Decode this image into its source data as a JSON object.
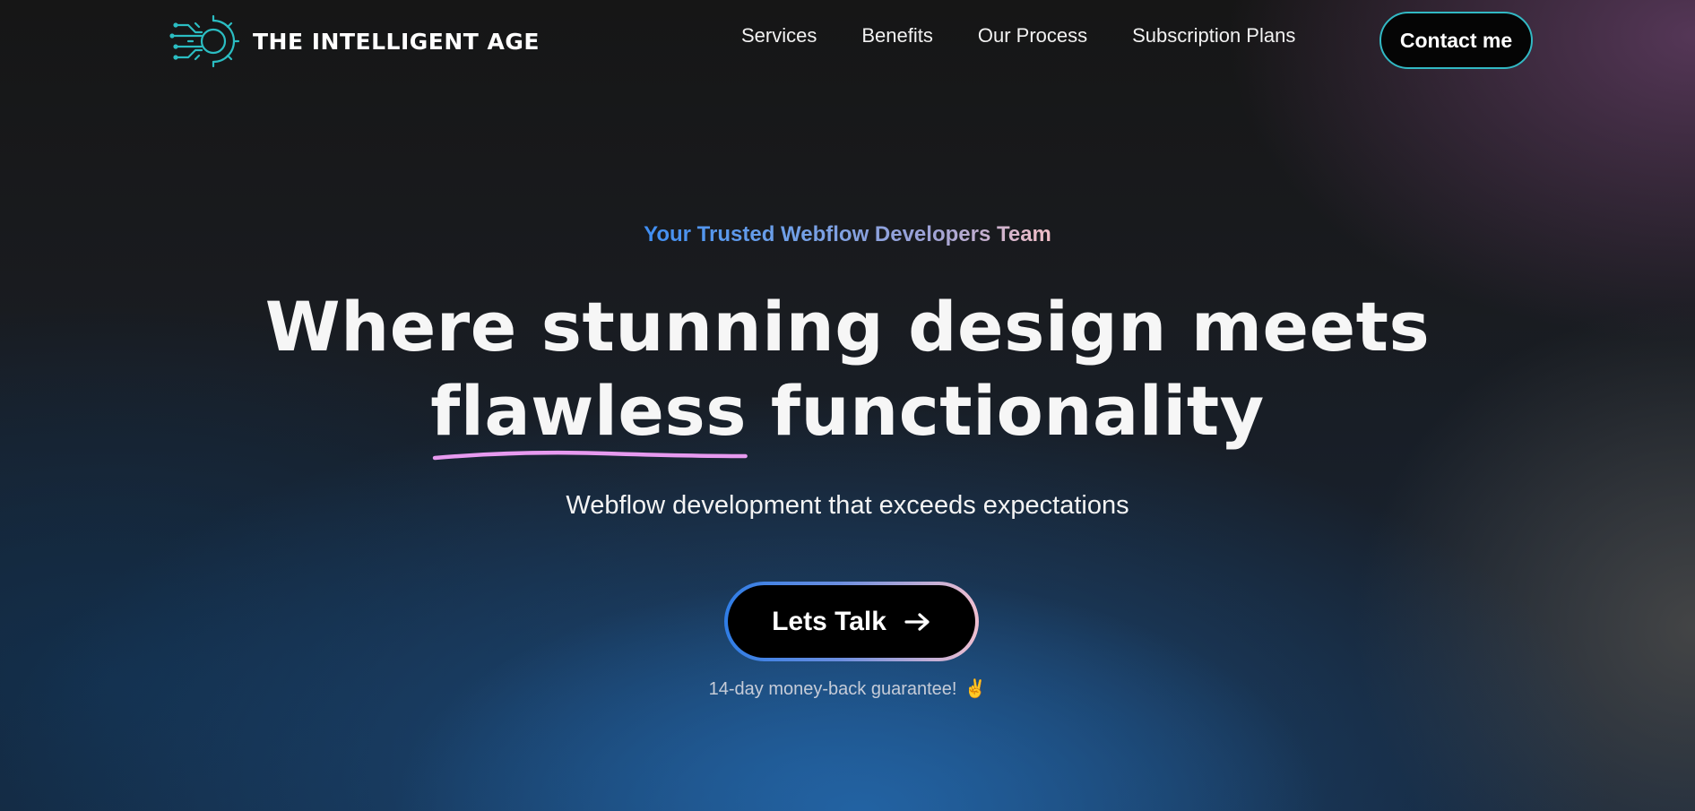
{
  "header": {
    "brand": "THE INTELLIGENT AGE",
    "nav": [
      {
        "label": "Services"
      },
      {
        "label": "Benefits"
      },
      {
        "label": "Our Process"
      },
      {
        "label": "Subscription Plans"
      }
    ],
    "contact_label": "Contact me"
  },
  "hero": {
    "eyebrow": "Your Trusted Webflow Developers Team",
    "headline_line1": "Where stunning design meets",
    "headline_underlined": "flawless",
    "headline_line2_rest": "functionality",
    "subtitle": "Webflow development that exceeds expectations",
    "cta_label": "Lets Talk",
    "guarantee": "14-day money-back guarantee!"
  },
  "icons": {
    "logo": "gear-circuit-icon",
    "cta": "arrow-right-icon",
    "guarantee": "victory-hand-icon"
  },
  "colors": {
    "accent_teal": "#32b9c4",
    "eyebrow_start": "#3f8ef2",
    "eyebrow_end": "#f3bfc7",
    "underline": "#e79af0"
  }
}
